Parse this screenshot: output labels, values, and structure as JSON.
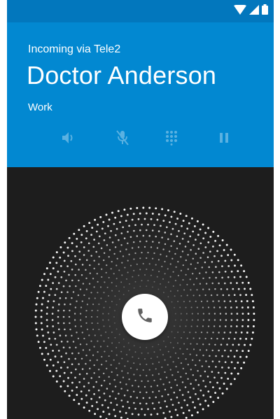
{
  "status_bar": {
    "wifi_icon": "wifi-icon",
    "signal_icon": "cell-signal-icon",
    "battery_icon": "battery-icon"
  },
  "call": {
    "via": "Incoming via Tele2",
    "caller_name": "Doctor Anderson",
    "number_label": "Work"
  },
  "controls": [
    {
      "name": "speaker",
      "icon": "speaker-icon"
    },
    {
      "name": "mute",
      "icon": "mic-off-icon"
    },
    {
      "name": "dialpad",
      "icon": "dialpad-icon"
    },
    {
      "name": "hold",
      "icon": "pause-icon"
    }
  ],
  "answer": {
    "icon": "phone-icon"
  },
  "colors": {
    "status_bar": "#0277bd",
    "header": "#0288d1",
    "background": "#1d1d1d",
    "answer_button": "#ffffff",
    "phone_glyph": "#616161"
  }
}
